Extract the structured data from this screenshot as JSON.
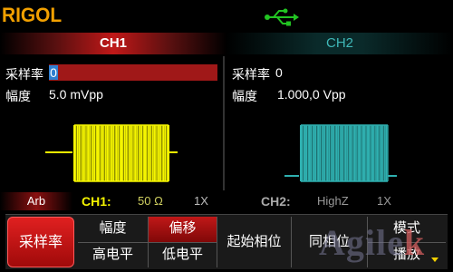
{
  "brand": "RIGOL",
  "icons": {
    "usb": "usb-icon"
  },
  "colors": {
    "ch1": "#f5f500",
    "ch2": "#2fb0b0",
    "accent": "#c01818",
    "brand": "#f2a000"
  },
  "tabs": [
    {
      "label": "CH1",
      "active": true
    },
    {
      "label": "CH2",
      "active": false
    }
  ],
  "ch1": {
    "sample_rate_label": "采样率",
    "sample_rate_value": "0",
    "amplitude_label": "幅度",
    "amplitude_value": "5.0 mVpp"
  },
  "ch2": {
    "sample_rate_label": "采样率",
    "sample_rate_value": "0",
    "amplitude_label": "幅度",
    "amplitude_value": "1.000,0 Vpp"
  },
  "status": {
    "mode": "Arb",
    "ch1_label": "CH1:",
    "ch1_impedance": "50 Ω",
    "ch1_mult": "1X",
    "ch2_label": "CH2:",
    "ch2_impedance": "HighZ",
    "ch2_mult": "1X"
  },
  "softkeys": {
    "k1": "采样率",
    "k2_top": "幅度",
    "k2_bot": "高电平",
    "k3_top": "偏移",
    "k3_bot": "低电平",
    "k4": "起始相位",
    "k5": "同相位",
    "k6_top": "模式",
    "k6_bot": "播放"
  },
  "watermark": {
    "main": "Agile",
    "accent": "k"
  }
}
